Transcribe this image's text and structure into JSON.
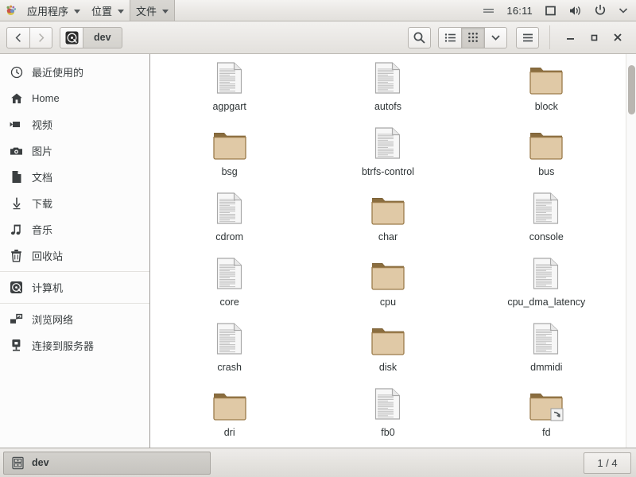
{
  "top_panel": {
    "logo_icon": "mate-footprint-logo-icon",
    "menus": [
      {
        "label": "应用程序",
        "icon": "menu-arrow-icon",
        "active": false
      },
      {
        "label": "位置",
        "icon": "menu-arrow-icon",
        "active": false
      },
      {
        "label": "文件",
        "icon": "menu-arrow-icon",
        "active": true
      }
    ],
    "right": {
      "window_list_icon": "minimize-indicator-icon",
      "clock": "16:11",
      "workspace_icon": "workspace-square-icon",
      "volume_icon": "speaker-volume-icon",
      "power_icon": "power-button-icon",
      "dropdown_icon": "chevron-down-icon"
    }
  },
  "window": {
    "titlebar": {
      "back_icon": "chevron-left-icon",
      "forward_icon": "chevron-right-icon",
      "path_icon": "computer-disk-icon",
      "path_crumb": "dev",
      "search_icon": "search-magnifier-icon",
      "list_view_icon": "list-view-icon",
      "grid_view_icon": "grid-view-icon",
      "view_dropdown_icon": "chevron-down-icon",
      "menu_icon": "hamburger-menu-icon",
      "minimize_icon": "window-minimize-icon",
      "maximize_icon": "window-maximize-icon",
      "close_icon": "window-close-icon"
    },
    "sidebar": [
      {
        "label": "最近使用的",
        "icon": "clock-recent-icon",
        "separator_after": false
      },
      {
        "label": "Home",
        "icon": "home-house-icon",
        "separator_after": false
      },
      {
        "label": "视频",
        "icon": "video-camera-icon",
        "separator_after": false
      },
      {
        "label": "图片",
        "icon": "camera-photo-icon",
        "separator_after": false
      },
      {
        "label": "文档",
        "icon": "document-page-icon",
        "separator_after": false
      },
      {
        "label": "下载",
        "icon": "download-arrow-icon",
        "separator_after": false
      },
      {
        "label": "音乐",
        "icon": "music-note-icon",
        "separator_after": false
      },
      {
        "label": "回收站",
        "icon": "trash-bin-icon",
        "separator_after": true
      },
      {
        "label": "计算机",
        "icon": "computer-disk-icon",
        "separator_after": true
      },
      {
        "label": "浏览网络",
        "icon": "network-browse-icon",
        "separator_after": false
      },
      {
        "label": "连接到服务器",
        "icon": "server-connect-icon",
        "separator_after": false
      }
    ],
    "files": [
      {
        "name": "agpgart",
        "type": "document"
      },
      {
        "name": "autofs",
        "type": "document"
      },
      {
        "name": "block",
        "type": "folder"
      },
      {
        "name": "bsg",
        "type": "folder"
      },
      {
        "name": "btrfs-control",
        "type": "document"
      },
      {
        "name": "bus",
        "type": "folder"
      },
      {
        "name": "cdrom",
        "type": "document"
      },
      {
        "name": "char",
        "type": "folder"
      },
      {
        "name": "console",
        "type": "document"
      },
      {
        "name": "core",
        "type": "document"
      },
      {
        "name": "cpu",
        "type": "folder"
      },
      {
        "name": "cpu_dma_latency",
        "type": "document"
      },
      {
        "name": "crash",
        "type": "document"
      },
      {
        "name": "disk",
        "type": "folder"
      },
      {
        "name": "dmmidi",
        "type": "document"
      },
      {
        "name": "dri",
        "type": "folder"
      },
      {
        "name": "fb0",
        "type": "document"
      },
      {
        "name": "fd",
        "type": "folder-symlink"
      }
    ],
    "scrollbar": {
      "orientation": "vertical",
      "thumb_at_top": true
    }
  },
  "bottom_panel": {
    "task_button": {
      "label": "dev",
      "icon": "file-manager-icon"
    },
    "workspace_switcher": {
      "label": "1 / 4"
    }
  },
  "colors": {
    "folder": "#e0c9a6",
    "folder_tab": "#8a6d3f",
    "folder_border": "#9b7b4a",
    "document": "#f7f7f7",
    "document_border": "#a8a8a8",
    "panel_bg": "#e7e5e1",
    "text": "#2e3436"
  }
}
